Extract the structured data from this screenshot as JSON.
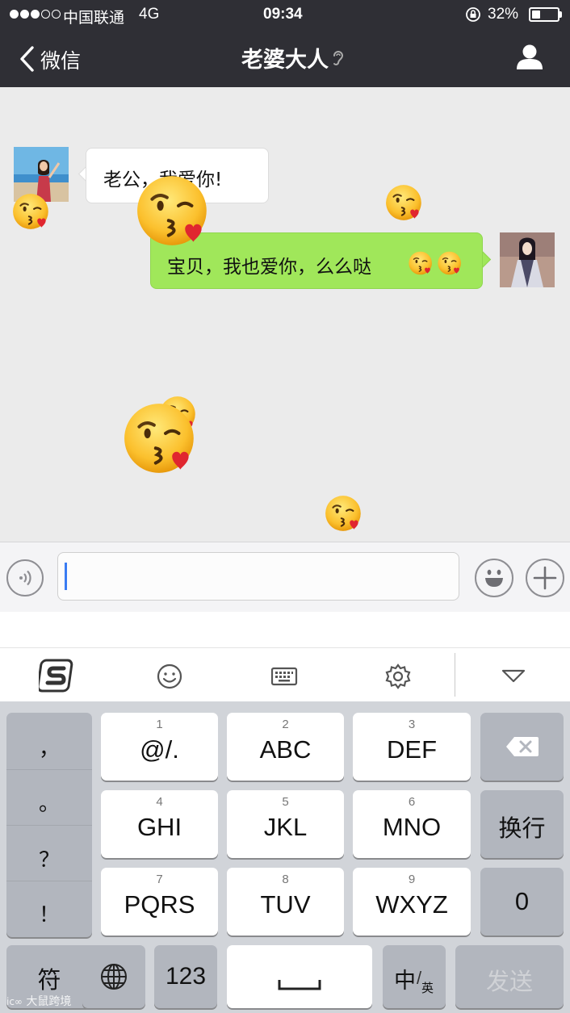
{
  "status_bar": {
    "carrier": "中国联通",
    "network": "4G",
    "time": "09:34",
    "battery_percent": "32%",
    "battery_level": 0.32
  },
  "nav": {
    "back_label": "微信",
    "title": "老婆大人",
    "profile_icon": "person-icon",
    "back_icon": "chevron-left-icon",
    "earpiece_icon": "ear-icon"
  },
  "chat": {
    "messages": [
      {
        "side": "left",
        "text": "老公，我爱你!"
      },
      {
        "side": "right",
        "text": "宝贝，我也爱你，么么哒"
      }
    ],
    "falling_emoji": "kiss-emoji"
  },
  "input_bar": {
    "voice_icon": "voice-icon",
    "emoji_icon": "smiley-icon",
    "plus_icon": "plus-icon"
  },
  "keyboard_toolbar": {
    "icons": [
      "sogou-logo",
      "emoji-icon",
      "keyboard-icon",
      "gear-icon",
      "collapse-icon"
    ]
  },
  "keyboard": {
    "punctuation": [
      "，",
      "。",
      "？",
      "！"
    ],
    "keys": [
      {
        "num": "1",
        "label": "@/."
      },
      {
        "num": "2",
        "label": "ABC"
      },
      {
        "num": "3",
        "label": "DEF"
      },
      {
        "num": "4",
        "label": "GHI"
      },
      {
        "num": "5",
        "label": "JKL"
      },
      {
        "num": "6",
        "label": "MNO"
      },
      {
        "num": "7",
        "label": "PQRS"
      },
      {
        "num": "8",
        "label": "TUV"
      },
      {
        "num": "9",
        "label": "WXYZ"
      }
    ],
    "newline": "换行",
    "zero": "0",
    "symbols": "符",
    "numbers": "123",
    "lang_main": "中",
    "lang_sub": "英",
    "send": "发送"
  },
  "watermark": "大鼠跨境"
}
